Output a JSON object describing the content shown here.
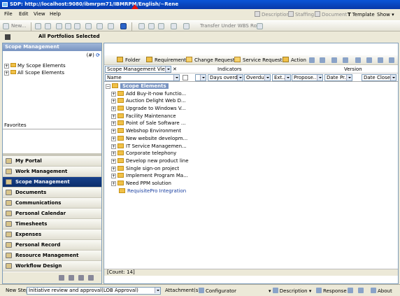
{
  "window": {
    "title": "SDP: http://localhost:9080/ibmrpm71/IBMRPM/English/~Rene"
  },
  "menu": {
    "file": "File",
    "edit": "Edit",
    "view": "View",
    "help": "Help"
  },
  "top_right": {
    "description": "Description",
    "staffing": "Staffing",
    "document": "Document",
    "template": "Template",
    "show": "Show"
  },
  "toolbar": {
    "new": "New...",
    "transfer": "Transfer Under WBS Root"
  },
  "portfolio": {
    "label": "All Portfolios Selected"
  },
  "left_pane": {
    "header": "Scope Management",
    "tools": "(#)",
    "tree": [
      {
        "label": "My Scope Elements",
        "expand": "+"
      },
      {
        "label": "All Scope Elements",
        "expand": "+"
      }
    ],
    "favorites_label": "Favorites"
  },
  "nav": {
    "items": [
      {
        "label": "My Portal",
        "active": false
      },
      {
        "label": "Work Management",
        "active": false
      },
      {
        "label": "Scope Management",
        "active": true
      },
      {
        "label": "Documents",
        "active": false
      },
      {
        "label": "Communications",
        "active": false
      },
      {
        "label": "Personal Calendar",
        "active": false
      },
      {
        "label": "Timesheets",
        "active": false
      },
      {
        "label": "Expenses",
        "active": false
      },
      {
        "label": "Personal Record",
        "active": false
      },
      {
        "label": "Resource Management",
        "active": false
      },
      {
        "label": "Workflow Design",
        "active": false
      }
    ]
  },
  "main": {
    "toolbar": {
      "folder": "Folder",
      "requirement": "Requirement",
      "change_request": "Change Request",
      "service_request": "Service Request",
      "action": "Action"
    },
    "view_select": "Scope Management View",
    "indicators_label": "Indicators",
    "version_label": "Version",
    "name_col": "Name",
    "columns": {
      "days_overdue": "Days overdue",
      "overdue": "Overdue",
      "ext": "Ext...",
      "propose": "Propose...",
      "date_pr": "Date Pr...",
      "date_closed": "Date Closed"
    },
    "root": "Scope Elements",
    "items": [
      "Add Buy-it-now functio...",
      "Auction Delight Web D...",
      "Upgrade to Windows V...",
      "Facility Maintenance",
      "Point of Sale Software ...",
      "Webshop Environment",
      "New website developm...",
      "IT Service Managemen...",
      "Corporate telephony",
      "Develop new product line",
      "Single sign-on project",
      "Implement Program Ma...",
      "Need PPM solution"
    ],
    "link_item": "RequisitePro Integration",
    "count": "[Count: 14]"
  },
  "statusbar": {
    "new_step_label": "New Step",
    "workflow": "Initiative review and approval(LOB Approval)",
    "attachments": "Attachment(s)",
    "configurator": "Configurator",
    "description": "Description",
    "response": "Response",
    "about": "About"
  }
}
